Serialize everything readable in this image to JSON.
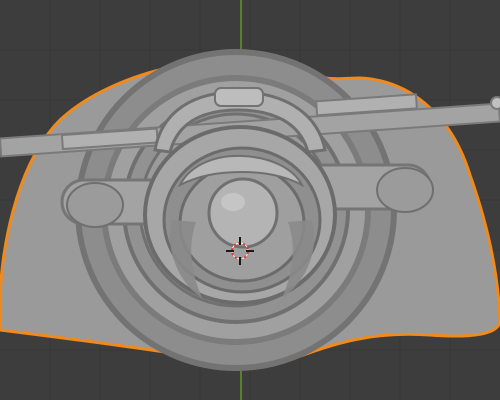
{
  "viewport": {
    "mode": "object-selected-3d-view",
    "background_color": "#3d3d3d",
    "grid_color": "#363636",
    "axis_green_color": "#5a8a2a",
    "selection_outline_color": "#f08a1c",
    "model_base_color": "#9a9a9a",
    "model_detail_color": "#a9a9a9",
    "model_shadow_color": "#7f7f7f",
    "model_highlight_color": "#c9c9c9",
    "cursor_red": "#d23a2f",
    "cursor_white": "#f0f0f0"
  },
  "icons": {
    "cursor": "3d-cursor-icon",
    "object": "trophy-plaque-model"
  }
}
